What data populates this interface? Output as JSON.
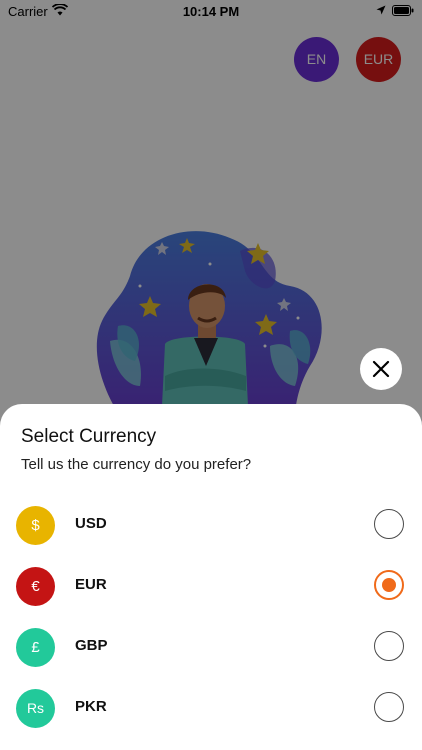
{
  "status_bar": {
    "carrier": "Carrier",
    "time": "10:14 PM"
  },
  "header": {
    "language_label": "EN",
    "currency_label": "EUR",
    "language_color": "#6a2ed8",
    "currency_color": "#d81d1d"
  },
  "sheet": {
    "title": "Select Currency",
    "subtitle": "Tell us the currency do you prefer?",
    "selected_code": "EUR",
    "accent_color": "#f06a1a"
  },
  "currencies": [
    {
      "symbol": "$",
      "code": "USD",
      "color": "#e8b400",
      "selected": false
    },
    {
      "symbol": "€",
      "code": "EUR",
      "color": "#c41414",
      "selected": true
    },
    {
      "symbol": "£",
      "code": "GBP",
      "color": "#22c99a",
      "selected": false
    },
    {
      "symbol": "Rs",
      "code": "PKR",
      "color": "#22c99a",
      "selected": false
    }
  ],
  "icons": [
    "wifi-icon",
    "location-icon",
    "battery-icon",
    "close-icon"
  ]
}
